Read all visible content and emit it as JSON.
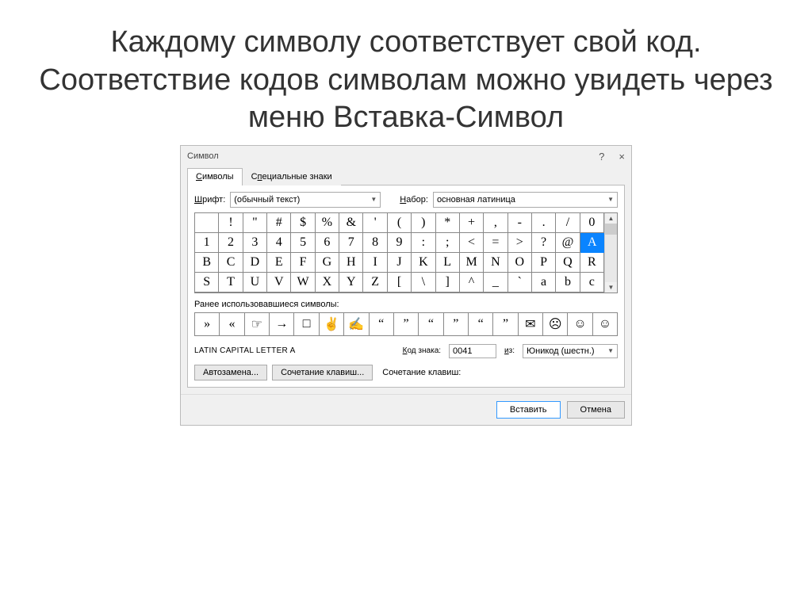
{
  "heading": "Каждому символу соответствует свой код.\nСоответствие кодов символам можно увидеть через меню Вставка-Символ",
  "dialog": {
    "title": "Символ",
    "help": "?",
    "close": "×"
  },
  "tabs": {
    "symbols": "Символы",
    "symbols_u": "С",
    "special": "Специальные знаки",
    "special_u": "п"
  },
  "font": {
    "label": "Шрифт:",
    "label_u": "Ш",
    "value": "(обычный текст)"
  },
  "subset": {
    "label": "Набор:",
    "label_u": "Н",
    "value": "основная латиница"
  },
  "grid": [
    [
      "",
      "!",
      "\"",
      "#",
      "$",
      "%",
      "&",
      "'",
      "(",
      ")",
      "*",
      "+",
      ",",
      "-",
      ".",
      "/",
      "0"
    ],
    [
      "1",
      "2",
      "3",
      "4",
      "5",
      "6",
      "7",
      "8",
      "9",
      ":",
      ";",
      "<",
      "=",
      ">",
      "?",
      "@",
      "A"
    ],
    [
      "B",
      "C",
      "D",
      "E",
      "F",
      "G",
      "H",
      "I",
      "J",
      "K",
      "L",
      "M",
      "N",
      "O",
      "P",
      "Q",
      "R"
    ],
    [
      "S",
      "T",
      "U",
      "V",
      "W",
      "X",
      "Y",
      "Z",
      "[",
      "\\",
      "]",
      "^",
      "_",
      "`",
      "a",
      "b",
      "c"
    ]
  ],
  "selected_char": "A",
  "recent": {
    "label": "Ранее использовавшиеся символы:",
    "chars": [
      "»",
      "«",
      "☞",
      "→",
      "□",
      "✌",
      "✍",
      "“",
      "”",
      "“",
      "”",
      "“",
      "”",
      "✉",
      "☹",
      "☺",
      "☺"
    ]
  },
  "info": {
    "name": "LATIN CAPITAL LETTER A",
    "code_label": "Код знака:",
    "code_label_u": "К",
    "code_value": "0041",
    "from_label": "из:",
    "from_label_u": "и",
    "from_value": "Юникод (шестн.)"
  },
  "buttons": {
    "autocorrect": "Автозамена...",
    "shortcut": "Сочетание клавиш...",
    "shortcut_label": "Сочетание клавиш:",
    "insert": "Вставить",
    "cancel": "Отмена"
  }
}
